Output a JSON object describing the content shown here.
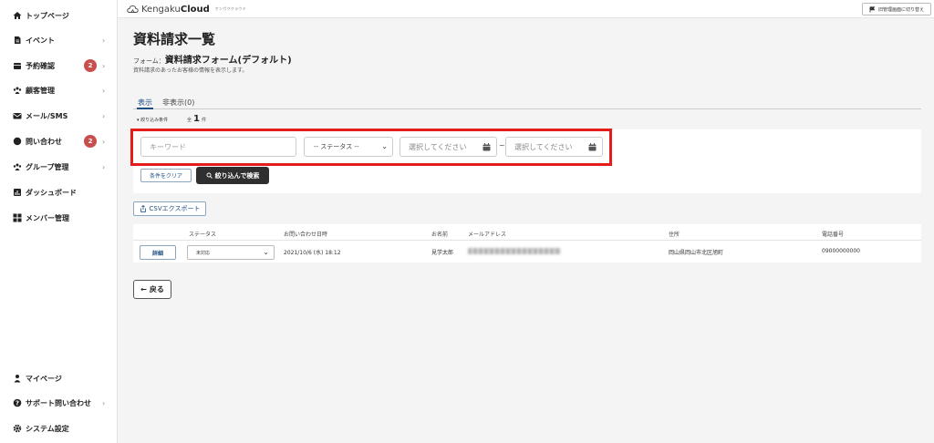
{
  "sidebar": {
    "items": [
      {
        "label": "トップページ",
        "icon": "home-icon",
        "chevron": false
      },
      {
        "label": "イベント",
        "icon": "document-icon",
        "chevron": true
      },
      {
        "label": "予約確認",
        "icon": "calendar-icon",
        "chevron": true,
        "badge": "2"
      },
      {
        "label": "顧客管理",
        "icon": "users-icon",
        "chevron": true
      },
      {
        "label": "メール/SMS",
        "icon": "mail-icon",
        "chevron": true
      },
      {
        "label": "問い合わせ",
        "icon": "chat-icon",
        "chevron": true,
        "badge": "2"
      },
      {
        "label": "グループ管理",
        "icon": "group-icon",
        "chevron": true
      },
      {
        "label": "ダッシュボード",
        "icon": "chart-icon",
        "chevron": false
      },
      {
        "label": "メンバー管理",
        "icon": "grid-icon",
        "chevron": false
      }
    ],
    "bottom_items": [
      {
        "label": "マイページ",
        "icon": "person-icon",
        "chevron": false
      },
      {
        "label": "サポート問い合わせ",
        "icon": "help-icon",
        "chevron": true
      },
      {
        "label": "システム設定",
        "icon": "gear-icon",
        "chevron": false
      }
    ]
  },
  "header": {
    "logo_prefix": "Kengaku",
    "logo_bold": "Cloud",
    "logo_sub": "ケンガククラウド",
    "switch_label": "旧管理画面に切り替え"
  },
  "page": {
    "title": "資料請求一覧",
    "form_prefix": "フォーム：",
    "form_name": "資料請求フォーム(デフォルト)",
    "description": "資料請求のあったお客様の情報を表示します。"
  },
  "tabs": [
    {
      "label": "表示",
      "active": true
    },
    {
      "label": "非表示(0)",
      "active": false
    }
  ],
  "filter": {
    "toggle_label": "▾ 絞り込み条件",
    "count_prefix": "全",
    "count": "1",
    "count_suffix": "件",
    "keyword_placeholder": "キーワード",
    "status_placeholder": "-- ステータス --",
    "date_from_placeholder": "選択してください",
    "date_to_placeholder": "選択してください",
    "range_sep": "~",
    "clear_label": "条件をクリア",
    "search_label": "絞り込んで検索"
  },
  "export": {
    "csv_label": "CSVエクスポート"
  },
  "table": {
    "columns": [
      "ステータス",
      "お問い合わせ日時",
      "お名前",
      "メールアドレス",
      "住所",
      "電話番号"
    ],
    "rows": [
      {
        "detail_label": "詳細",
        "status": "未対応",
        "datetime": "2021/10/6 (水) 18:12",
        "name": "見学太郎",
        "address": "岡山県岡山市北区旭町",
        "phone": "09000000000"
      }
    ]
  },
  "back_label": "戻る",
  "colors": {
    "accent": "#1f4f80",
    "badge": "#c94e4e",
    "highlight": "#e51c1c",
    "dark_button": "#2f2f2f"
  }
}
